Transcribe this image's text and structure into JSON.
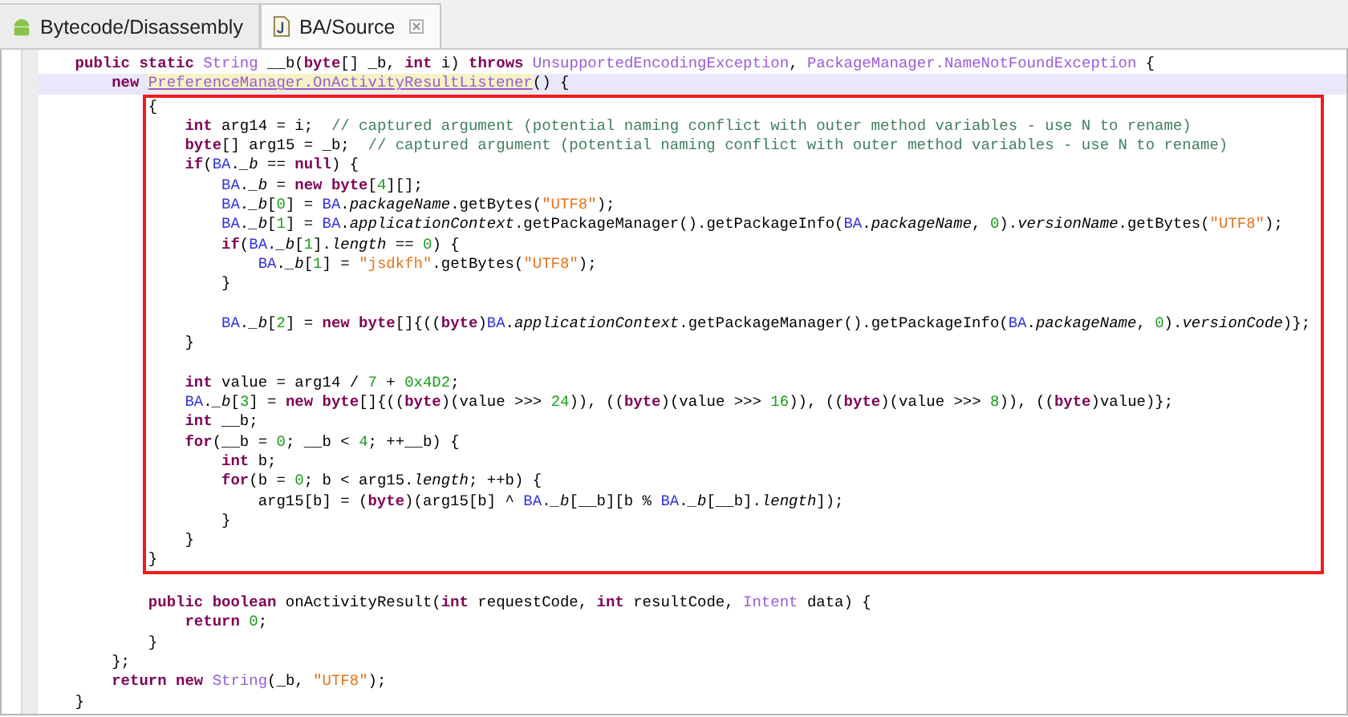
{
  "tabs": [
    {
      "label": "Bytecode/Disassembly",
      "kind": "bytecode",
      "selected": false,
      "closable": false
    },
    {
      "label": "BA/Source",
      "kind": "source",
      "selected": true,
      "closable": true
    }
  ],
  "editor": {
    "lines_before": [
      {
        "current": false,
        "tokens": [
          {
            "kind": "kw",
            "text": "    public static"
          },
          {
            "kind": "type",
            "text": " String"
          },
          {
            "kind": "plain",
            "text": " __b("
          },
          {
            "kind": "kw",
            "text": "byte"
          },
          {
            "kind": "plain",
            "text": "[] _b, "
          },
          {
            "kind": "kw",
            "text": "int"
          },
          {
            "kind": "plain",
            "text": " i) "
          },
          {
            "kind": "kw",
            "text": "throws"
          },
          {
            "kind": "type",
            "text": " UnsupportedEncodingException"
          },
          {
            "kind": "plain",
            "text": ", "
          },
          {
            "kind": "type",
            "text": "PackageManager.NameNotFoundException"
          },
          {
            "kind": "plain",
            "text": " {"
          }
        ]
      },
      {
        "current": true,
        "tokens": [
          {
            "kind": "kw",
            "text": "        new "
          },
          {
            "kind": "ref",
            "text": "PreferenceManager.OnActivityResultListener"
          },
          {
            "kind": "plain",
            "text": "() {"
          }
        ]
      }
    ],
    "marked_region": {
      "lines": [
        {
          "current": false,
          "tokens": [
            {
              "kind": "plain",
              "text": "            {"
            }
          ]
        },
        {
          "current": false,
          "tokens": [
            {
              "kind": "kw",
              "text": "                int"
            },
            {
              "kind": "plain",
              "text": " arg14 = i;  "
            },
            {
              "kind": "comment",
              "text": "// captured argument (potential naming conflict with outer method variables - use N to rename)"
            }
          ]
        },
        {
          "current": false,
          "tokens": [
            {
              "kind": "kw",
              "text": "                byte"
            },
            {
              "kind": "plain",
              "text": "[] arg15 = _b;  "
            },
            {
              "kind": "comment",
              "text": "// captured argument (potential naming conflict with outer method variables - use N to rename)"
            }
          ]
        },
        {
          "current": false,
          "tokens": [
            {
              "kind": "kw",
              "text": "                if"
            },
            {
              "kind": "plain",
              "text": "("
            },
            {
              "kind": "cls",
              "text": "BA"
            },
            {
              "kind": "plain",
              "text": "."
            },
            {
              "kind": "field",
              "text": "_b"
            },
            {
              "kind": "plain",
              "text": " == "
            },
            {
              "kind": "kw",
              "text": "null"
            },
            {
              "kind": "plain",
              "text": ") {"
            }
          ]
        },
        {
          "current": false,
          "tokens": [
            {
              "kind": "cls",
              "text": "                    BA"
            },
            {
              "kind": "plain",
              "text": "."
            },
            {
              "kind": "field",
              "text": "_b"
            },
            {
              "kind": "plain",
              "text": " = "
            },
            {
              "kind": "kw",
              "text": "new byte"
            },
            {
              "kind": "plain",
              "text": "["
            },
            {
              "kind": "num",
              "text": "4"
            },
            {
              "kind": "plain",
              "text": "][];"
            }
          ]
        },
        {
          "current": false,
          "tokens": [
            {
              "kind": "cls",
              "text": "                    BA"
            },
            {
              "kind": "plain",
              "text": "."
            },
            {
              "kind": "field",
              "text": "_b"
            },
            {
              "kind": "plain",
              "text": "["
            },
            {
              "kind": "num",
              "text": "0"
            },
            {
              "kind": "plain",
              "text": "] = "
            },
            {
              "kind": "cls",
              "text": "BA"
            },
            {
              "kind": "plain",
              "text": "."
            },
            {
              "kind": "field",
              "text": "packageName"
            },
            {
              "kind": "plain",
              "text": ".getBytes("
            },
            {
              "kind": "str",
              "text": "\"UTF8\""
            },
            {
              "kind": "plain",
              "text": ");"
            }
          ]
        },
        {
          "current": false,
          "tokens": [
            {
              "kind": "cls",
              "text": "                    BA"
            },
            {
              "kind": "plain",
              "text": "."
            },
            {
              "kind": "field",
              "text": "_b"
            },
            {
              "kind": "plain",
              "text": "["
            },
            {
              "kind": "num",
              "text": "1"
            },
            {
              "kind": "plain",
              "text": "] = "
            },
            {
              "kind": "cls",
              "text": "BA"
            },
            {
              "kind": "plain",
              "text": "."
            },
            {
              "kind": "field",
              "text": "applicationContext"
            },
            {
              "kind": "plain",
              "text": ".getPackageManager().getPackageInfo("
            },
            {
              "kind": "cls",
              "text": "BA"
            },
            {
              "kind": "plain",
              "text": "."
            },
            {
              "kind": "field",
              "text": "packageName"
            },
            {
              "kind": "plain",
              "text": ", "
            },
            {
              "kind": "num",
              "text": "0"
            },
            {
              "kind": "plain",
              "text": ")."
            },
            {
              "kind": "field",
              "text": "versionName"
            },
            {
              "kind": "plain",
              "text": ".getBytes("
            },
            {
              "kind": "str",
              "text": "\"UTF8\""
            },
            {
              "kind": "plain",
              "text": ");"
            }
          ]
        },
        {
          "current": false,
          "tokens": [
            {
              "kind": "kw",
              "text": "                    if"
            },
            {
              "kind": "plain",
              "text": "("
            },
            {
              "kind": "cls",
              "text": "BA"
            },
            {
              "kind": "plain",
              "text": "."
            },
            {
              "kind": "field",
              "text": "_b"
            },
            {
              "kind": "plain",
              "text": "["
            },
            {
              "kind": "num",
              "text": "1"
            },
            {
              "kind": "plain",
              "text": "]."
            },
            {
              "kind": "field",
              "text": "length"
            },
            {
              "kind": "plain",
              "text": " == "
            },
            {
              "kind": "num",
              "text": "0"
            },
            {
              "kind": "plain",
              "text": ") {"
            }
          ]
        },
        {
          "current": false,
          "tokens": [
            {
              "kind": "cls",
              "text": "                        BA"
            },
            {
              "kind": "plain",
              "text": "."
            },
            {
              "kind": "field",
              "text": "_b"
            },
            {
              "kind": "plain",
              "text": "["
            },
            {
              "kind": "num",
              "text": "1"
            },
            {
              "kind": "plain",
              "text": "] = "
            },
            {
              "kind": "str",
              "text": "\"jsdkfh\""
            },
            {
              "kind": "plain",
              "text": ".getBytes("
            },
            {
              "kind": "str",
              "text": "\"UTF8\""
            },
            {
              "kind": "plain",
              "text": ");"
            }
          ]
        },
        {
          "current": false,
          "tokens": [
            {
              "kind": "plain",
              "text": "                    }"
            }
          ]
        },
        {
          "current": false
        },
        {
          "current": false,
          "tokens": [
            {
              "kind": "cls",
              "text": "                    BA"
            },
            {
              "kind": "plain",
              "text": "."
            },
            {
              "kind": "field",
              "text": "_b"
            },
            {
              "kind": "plain",
              "text": "["
            },
            {
              "kind": "num",
              "text": "2"
            },
            {
              "kind": "plain",
              "text": "] = "
            },
            {
              "kind": "kw",
              "text": "new byte"
            },
            {
              "kind": "plain",
              "text": "[]{(("
            },
            {
              "kind": "kw",
              "text": "byte"
            },
            {
              "kind": "plain",
              "text": ")"
            },
            {
              "kind": "cls",
              "text": "BA"
            },
            {
              "kind": "plain",
              "text": "."
            },
            {
              "kind": "field",
              "text": "applicationContext"
            },
            {
              "kind": "plain",
              "text": ".getPackageManager().getPackageInfo("
            },
            {
              "kind": "cls",
              "text": "BA"
            },
            {
              "kind": "plain",
              "text": "."
            },
            {
              "kind": "field",
              "text": "packageName"
            },
            {
              "kind": "plain",
              "text": ", "
            },
            {
              "kind": "num",
              "text": "0"
            },
            {
              "kind": "plain",
              "text": ")."
            },
            {
              "kind": "field",
              "text": "versionCode"
            },
            {
              "kind": "plain",
              "text": ")};"
            }
          ]
        },
        {
          "current": false,
          "tokens": [
            {
              "kind": "plain",
              "text": "                }"
            }
          ]
        },
        {
          "current": false
        },
        {
          "current": false,
          "tokens": [
            {
              "kind": "kw",
              "text": "                int"
            },
            {
              "kind": "plain",
              "text": " value = arg14 / "
            },
            {
              "kind": "num",
              "text": "7"
            },
            {
              "kind": "plain",
              "text": " + "
            },
            {
              "kind": "num",
              "text": "0x4D2"
            },
            {
              "kind": "plain",
              "text": ";"
            }
          ]
        },
        {
          "current": false,
          "tokens": [
            {
              "kind": "cls",
              "text": "                BA"
            },
            {
              "kind": "plain",
              "text": "."
            },
            {
              "kind": "field",
              "text": "_b"
            },
            {
              "kind": "plain",
              "text": "["
            },
            {
              "kind": "num",
              "text": "3"
            },
            {
              "kind": "plain",
              "text": "] = "
            },
            {
              "kind": "kw",
              "text": "new byte"
            },
            {
              "kind": "plain",
              "text": "[]{(("
            },
            {
              "kind": "kw",
              "text": "byte"
            },
            {
              "kind": "plain",
              "text": ")(value >>> "
            },
            {
              "kind": "num",
              "text": "24"
            },
            {
              "kind": "plain",
              "text": ")), (("
            },
            {
              "kind": "kw",
              "text": "byte"
            },
            {
              "kind": "plain",
              "text": ")(value >>> "
            },
            {
              "kind": "num",
              "text": "16"
            },
            {
              "kind": "plain",
              "text": ")), (("
            },
            {
              "kind": "kw",
              "text": "byte"
            },
            {
              "kind": "plain",
              "text": ")(value >>> "
            },
            {
              "kind": "num",
              "text": "8"
            },
            {
              "kind": "plain",
              "text": ")), (("
            },
            {
              "kind": "kw",
              "text": "byte"
            },
            {
              "kind": "plain",
              "text": ")value)};"
            }
          ]
        },
        {
          "current": false,
          "tokens": [
            {
              "kind": "kw",
              "text": "                int"
            },
            {
              "kind": "plain",
              "text": " __b;"
            }
          ]
        },
        {
          "current": false,
          "tokens": [
            {
              "kind": "kw",
              "text": "                for"
            },
            {
              "kind": "plain",
              "text": "(__b = "
            },
            {
              "kind": "num",
              "text": "0"
            },
            {
              "kind": "plain",
              "text": "; __b < "
            },
            {
              "kind": "num",
              "text": "4"
            },
            {
              "kind": "plain",
              "text": "; ++__b) {"
            }
          ]
        },
        {
          "current": false,
          "tokens": [
            {
              "kind": "kw",
              "text": "                    int"
            },
            {
              "kind": "plain",
              "text": " b;"
            }
          ]
        },
        {
          "current": false,
          "tokens": [
            {
              "kind": "kw",
              "text": "                    for"
            },
            {
              "kind": "plain",
              "text": "(b = "
            },
            {
              "kind": "num",
              "text": "0"
            },
            {
              "kind": "plain",
              "text": "; b < arg15."
            },
            {
              "kind": "field",
              "text": "length"
            },
            {
              "kind": "plain",
              "text": "; ++b) {"
            }
          ]
        },
        {
          "current": false,
          "tokens": [
            {
              "kind": "plain",
              "text": "                        arg15[b] = ("
            },
            {
              "kind": "kw",
              "text": "byte"
            },
            {
              "kind": "plain",
              "text": ")(arg15[b] ^ "
            },
            {
              "kind": "cls",
              "text": "BA"
            },
            {
              "kind": "plain",
              "text": "."
            },
            {
              "kind": "field",
              "text": "_b"
            },
            {
              "kind": "plain",
              "text": "[__b][b % "
            },
            {
              "kind": "cls",
              "text": "BA"
            },
            {
              "kind": "plain",
              "text": "."
            },
            {
              "kind": "field",
              "text": "_b"
            },
            {
              "kind": "plain",
              "text": "[__b]."
            },
            {
              "kind": "field",
              "text": "length"
            },
            {
              "kind": "plain",
              "text": "]);"
            }
          ]
        },
        {
          "current": false,
          "tokens": [
            {
              "kind": "plain",
              "text": "                    }"
            }
          ]
        },
        {
          "current": false,
          "tokens": [
            {
              "kind": "plain",
              "text": "                }"
            }
          ]
        },
        {
          "current": false,
          "tokens": [
            {
              "kind": "plain",
              "text": "            }"
            }
          ]
        }
      ]
    },
    "lines_after": [
      {
        "current": false
      },
      {
        "current": false,
        "tokens": [
          {
            "kind": "kw",
            "text": "            public boolean"
          },
          {
            "kind": "plain",
            "text": " onActivityResult("
          },
          {
            "kind": "kw",
            "text": "int"
          },
          {
            "kind": "plain",
            "text": " requestCode, "
          },
          {
            "kind": "kw",
            "text": "int"
          },
          {
            "kind": "plain",
            "text": " resultCode, "
          },
          {
            "kind": "type",
            "text": "Intent"
          },
          {
            "kind": "plain",
            "text": " data) {"
          }
        ]
      },
      {
        "current": false,
        "tokens": [
          {
            "kind": "kw",
            "text": "                return"
          },
          {
            "kind": "num",
            "text": " 0"
          },
          {
            "kind": "plain",
            "text": ";"
          }
        ]
      },
      {
        "current": false,
        "tokens": [
          {
            "kind": "plain",
            "text": "            }"
          }
        ]
      },
      {
        "current": false,
        "tokens": [
          {
            "kind": "plain",
            "text": "        };"
          }
        ]
      },
      {
        "current": false,
        "tokens": [
          {
            "kind": "kw",
            "text": "        return new"
          },
          {
            "kind": "type",
            "text": " String"
          },
          {
            "kind": "plain",
            "text": "(_b, "
          },
          {
            "kind": "str",
            "text": "\"UTF8\""
          },
          {
            "kind": "plain",
            "text": ");"
          }
        ]
      },
      {
        "current": false,
        "tokens": [
          {
            "kind": "plain",
            "text": "    }"
          }
        ]
      }
    ]
  }
}
